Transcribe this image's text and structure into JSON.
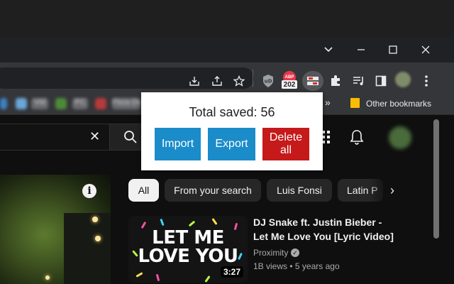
{
  "browser": {
    "colors": {
      "frame": "#202124",
      "toolbar": "#35363a"
    },
    "window_controls": {
      "minimize": "—",
      "maximize": "☐",
      "close": "✕",
      "tab_search": "⌄"
    },
    "extension_badge": {
      "label": "ABP",
      "count": "202"
    },
    "bookmarks_bar": {
      "blurred_items": [
        "Vid",
        "PC",
        "Fbza Demo"
      ],
      "overflow": "»",
      "other_bookmarks": "Other bookmarks"
    }
  },
  "popup": {
    "title": "Total saved: 56",
    "buttons": {
      "import": "Import",
      "export": "Export",
      "delete_all": "Delete all"
    },
    "colors": {
      "import": "#1a8cc9",
      "export": "#1a8cc9",
      "delete_all": "#c5191a"
    }
  },
  "youtube": {
    "search": {
      "clear": "✕"
    },
    "chips": [
      "All",
      "From your search",
      "Luis Fonsi",
      "Latin P"
    ],
    "chip_next": "›",
    "video": {
      "title": "DJ Snake ft. Justin Bieber - Let Me Love You [Lyric Video]",
      "thumbnail_text_line1": "LET ME",
      "thumbnail_text_line2": "LOVE YOU",
      "duration": "3:27",
      "channel": "Proximity",
      "views": "1B views",
      "age": "5 years ago",
      "separator": "•"
    },
    "info_glyph": "i"
  }
}
